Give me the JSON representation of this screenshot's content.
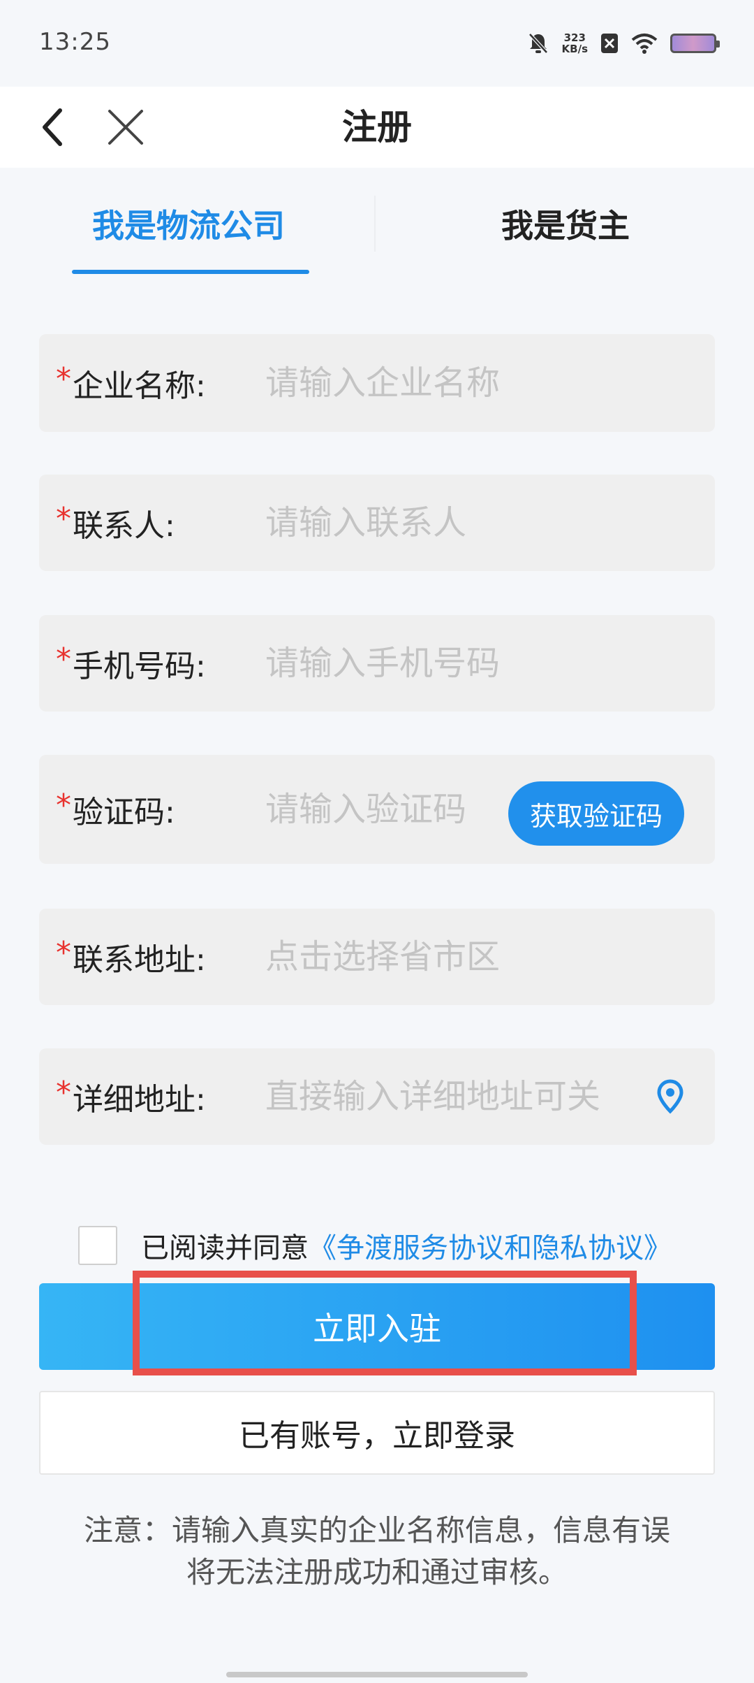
{
  "status_bar": {
    "time": "13:25",
    "net_speed_value": "323",
    "net_speed_unit": "KB/s"
  },
  "nav": {
    "title": "注册"
  },
  "tabs": [
    {
      "label": "我是物流公司",
      "active": true
    },
    {
      "label": "我是货主",
      "active": false
    }
  ],
  "form": {
    "required_mark": "*",
    "company": {
      "label": "企业名称:",
      "placeholder": "请输入企业名称",
      "value": ""
    },
    "contact": {
      "label": "联系人:",
      "placeholder": "请输入联系人",
      "value": ""
    },
    "phone": {
      "label": "手机号码:",
      "placeholder": "请输入手机号码",
      "value": ""
    },
    "code": {
      "label": "验证码:",
      "placeholder": "请输入验证码",
      "value": "",
      "button_label": "获取验证码"
    },
    "region": {
      "label": "联系地址:",
      "placeholder": "点击选择省市区",
      "value": ""
    },
    "address": {
      "label": "详细地址:",
      "placeholder": "直接输入详细地址可关",
      "value": ""
    }
  },
  "agreement": {
    "prefix": "已阅读并同意",
    "link": "《争渡服务协议和隐私协议》",
    "checked": false
  },
  "actions": {
    "submit_label": "立即入驻",
    "login_label": "已有账号，立即登录"
  },
  "notice": {
    "line1": "注意：请输入真实的企业名称信息，信息有误",
    "line2": "将无法注册成功和通过审核。"
  },
  "colors": {
    "accent": "#1f8be6",
    "required": "#e8322e",
    "highlight": "#e8504a"
  }
}
